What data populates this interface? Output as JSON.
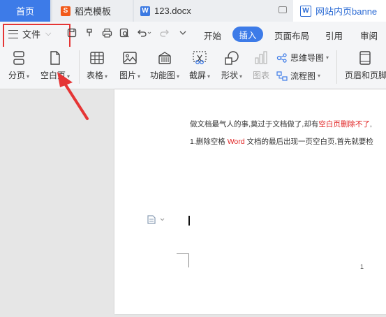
{
  "tabs": {
    "home": "首页",
    "template": "稻壳模板",
    "document": "123.docx",
    "web": "网站内页banne"
  },
  "menu": {
    "file_label": "文件",
    "items": [
      "开始",
      "插入",
      "页面布局",
      "引用",
      "审阅"
    ],
    "active": "插入"
  },
  "ribbon": {
    "page_break": "分页",
    "blank_page": "空白页",
    "table": "表格",
    "picture": "图片",
    "function_chart": "功能图",
    "screenshot": "截屏",
    "shape": "形状",
    "chart": "图表",
    "mindmap": "思维导图",
    "flowchart": "流程图",
    "header_footer": "页眉和页脚"
  },
  "document": {
    "line1_a": "做文档最气人的事,莫过于文档做了,却有",
    "line1_red": "空白页删除不了",
    "line1_b": ",",
    "line2_a": "1.删除空格 ",
    "line2_red": "Word",
    "line2_b": " 文档的最后出现一页空白页,首先就要检",
    "page_number": "1"
  },
  "colors": {
    "accent": "#3d7be8",
    "annotation_red": "#e53535",
    "text_red": "#e02020"
  },
  "icons": {
    "doc_tab": "word-icon",
    "template_tab": "daoke-icon",
    "web_tab": "web-doc-icon"
  }
}
